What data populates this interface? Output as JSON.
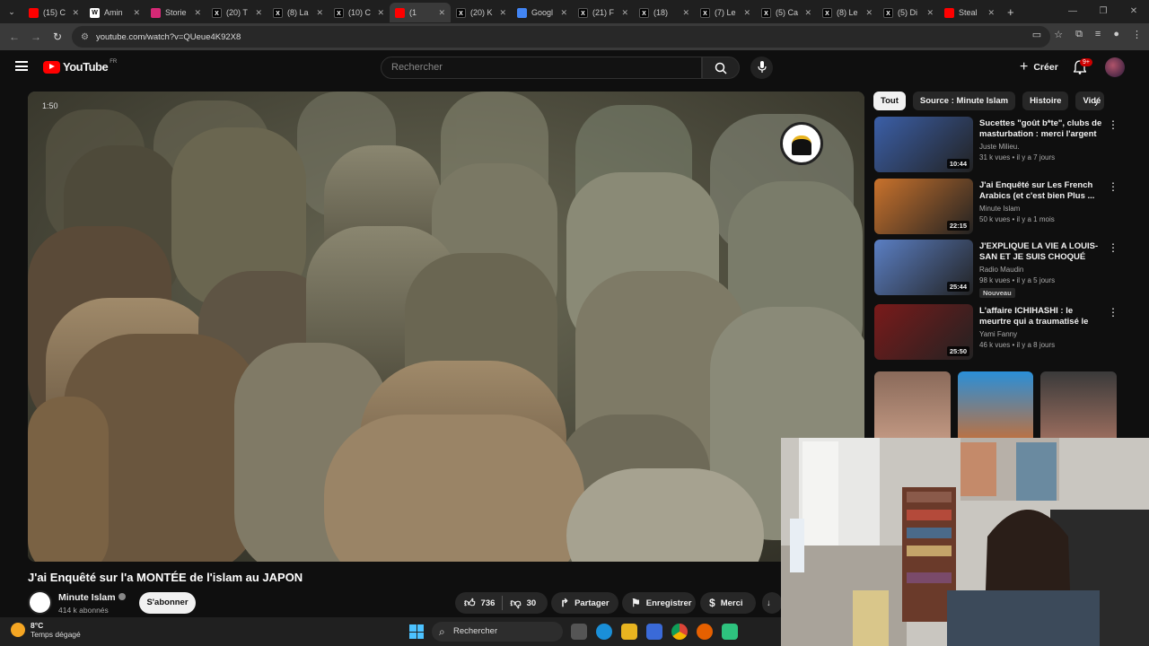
{
  "browser": {
    "tabs": [
      {
        "label": "(15) C",
        "icon": "youtube-icon",
        "color": "#ff0000"
      },
      {
        "label": "Amin",
        "icon": "wikipedia-icon",
        "color": "#ffffff"
      },
      {
        "label": "Storie",
        "icon": "instagram-icon",
        "color": "#d62976"
      },
      {
        "label": "(20) T",
        "icon": "x-icon",
        "color": "#000000"
      },
      {
        "label": "(8) La",
        "icon": "x-icon",
        "color": "#000000"
      },
      {
        "label": "(10) C",
        "icon": "x-icon",
        "color": "#000000"
      },
      {
        "label": "(1",
        "icon": "youtube-icon",
        "color": "#ff0000",
        "active": true
      },
      {
        "label": "(20) K",
        "icon": "x-icon",
        "color": "#000000"
      },
      {
        "label": "Googl",
        "icon": "google-icon",
        "color": "#4285f4"
      },
      {
        "label": "(21) F",
        "icon": "x-icon",
        "color": "#000000"
      },
      {
        "label": "(18)",
        "icon": "x-icon",
        "color": "#000000"
      },
      {
        "label": "(7) Le",
        "icon": "x-icon",
        "color": "#000000"
      },
      {
        "label": "(5) Ca",
        "icon": "x-icon",
        "color": "#000000"
      },
      {
        "label": "(8) Le",
        "icon": "x-icon",
        "color": "#000000"
      },
      {
        "label": "(5) Di",
        "icon": "x-icon",
        "color": "#000000"
      },
      {
        "label": "Steal",
        "icon": "youtube-icon",
        "color": "#ff0000"
      }
    ],
    "url": "youtube.com/watch?v=QUeue4K92X8"
  },
  "youtube": {
    "logo_text": "YouTube",
    "logo_region": "FR",
    "search_placeholder": "Rechercher",
    "create_label": "Créer",
    "notif_count": "9+"
  },
  "player": {
    "timecode": "1:50"
  },
  "video": {
    "title": "J'ai Enquêté sur l'a MONTÉE de l'islam au JAPON",
    "channel": "Minute Islam",
    "subscribers": "414 k abonnés",
    "subscribe_label": "S'abonner",
    "likes": "736",
    "dislikes": "30",
    "share_label": "Partager",
    "save_label": "Enregistrer",
    "thanks_label": "Merci"
  },
  "chips": [
    "Tout",
    "Source : Minute Islam",
    "Histoire",
    "Vidé"
  ],
  "recommendations": [
    {
      "title": "Sucettes \"goût b*te\", clubs de masturbation : merci l'argent ...",
      "channel": "Juste Milieu.",
      "meta": "31 k vues • il y a 7 jours",
      "duration": "10:44",
      "thumb_color": "#3b5fa8"
    },
    {
      "title": "J'ai Enquêté sur Les French Arabics (et c'est bien Plus ...",
      "channel": "Minute Islam",
      "meta": "50 k vues • il y a 1 mois",
      "duration": "22:15",
      "thumb_color": "#c9722c"
    },
    {
      "title": "J'EXPLIQUE LA VIE A LOUIS-SAN ET JE SUIS CHOQUÉ PAR ...",
      "channel": "Radio Maudin",
      "meta": "98 k vues • il y a 5 jours",
      "duration": "25:44",
      "badge": "Nouveau",
      "thumb_color": "#5b7fc4"
    },
    {
      "title": "L'affaire ICHIHASHI : le meurtre qui a traumatisé le Japon",
      "channel": "Yami Fanny",
      "meta": "46 k vues • il y a 8 jours",
      "duration": "25:50",
      "thumb_color": "#7a1a1a"
    }
  ],
  "taskbar": {
    "temp": "8°C",
    "weather": "Temps dégagé",
    "search_label": "Rechercher"
  }
}
